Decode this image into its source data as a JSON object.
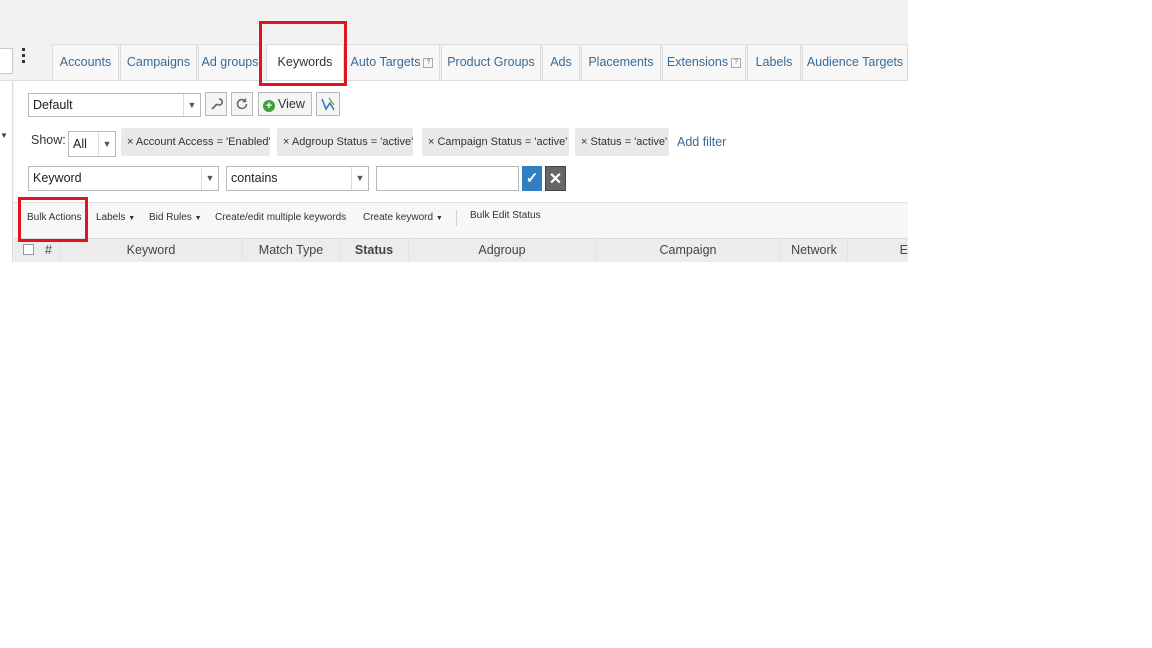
{
  "tabs": [
    {
      "label": "Accounts",
      "active": false
    },
    {
      "label": "Campaigns",
      "active": false
    },
    {
      "label": "Ad groups",
      "active": false
    },
    {
      "label": "Keywords",
      "active": true
    },
    {
      "label": "Auto Targets",
      "active": false,
      "help": "?"
    },
    {
      "label": "Product Groups",
      "active": false
    },
    {
      "label": "Ads",
      "active": false
    },
    {
      "label": "Placements",
      "active": false
    },
    {
      "label": "Extensions",
      "active": false,
      "help": "?"
    },
    {
      "label": "Labels",
      "active": false
    },
    {
      "label": "Audience Targets",
      "active": false
    }
  ],
  "view": {
    "selected": "Default",
    "view_button": "View",
    "icons": [
      "wrench-icon",
      "refresh-icon",
      "plus-circle-icon",
      "chart-icon"
    ]
  },
  "filters": {
    "show_label": "Show:",
    "show_value": "All",
    "chips": [
      "× Account Access = 'Enabled'",
      "× Adgroup Status = 'active'",
      "× Campaign Status = 'active'",
      "× Status = 'active'"
    ],
    "add_filter": "Add filter"
  },
  "search": {
    "field": "Keyword",
    "operator": "contains",
    "value": ""
  },
  "toolbar": {
    "bulk_actions": "Bulk Actions",
    "labels": "Labels",
    "bid_rules": "Bid Rules",
    "create_edit_multiple": "Create/edit multiple keywords",
    "create_keyword": "Create keyword",
    "bulk_edit_status": "Bulk Edit Status"
  },
  "table": {
    "columns": [
      "#",
      "Keyword",
      "Match Type",
      "Status",
      "Adgroup",
      "Campaign",
      "Network",
      "E"
    ]
  },
  "colors": {
    "highlight": "#e0131f",
    "link": "#3a6a96",
    "confirm": "#2f7fc1",
    "cancel": "#666666",
    "add_green": "#3ba13b"
  }
}
